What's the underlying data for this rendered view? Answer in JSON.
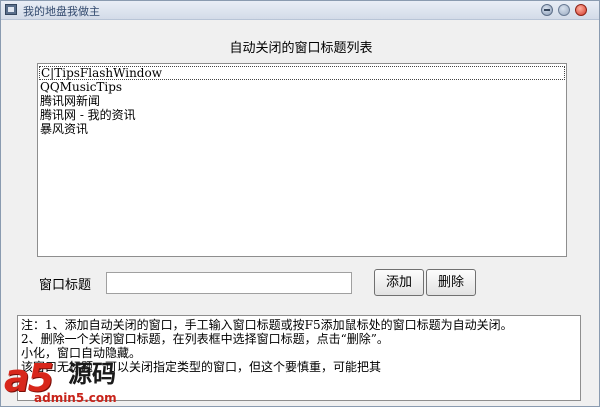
{
  "window": {
    "title": "我的地盘我做主",
    "colors": {
      "close": "#d2382a",
      "titlebar": "#d3dbe8"
    }
  },
  "list": {
    "title": "自动关闭的窗口标题列表",
    "items": [
      "C|TipsFlashWindow",
      "QQMusicTips",
      "腾讯网新闻",
      "腾讯网 - 我的资讯",
      "暴风资讯"
    ],
    "selected_index": 0
  },
  "form": {
    "label": "窗口标题",
    "input_value": "",
    "add_label": "添加",
    "delete_label": "删除"
  },
  "notes": {
    "lines": [
      "注：1、添加自动关闭的窗口，手工输入窗口标题或按F5添加鼠标处的窗口标题为自动关闭。",
      "2、删除一个关闭窗口标题，在列表框中选择窗口标题，点击“删除”。",
      "              小化，窗口自动隐藏。",
      "              该窗口无标题，可以关闭指定类型的窗口，但这个要慎重，可能把其"
    ]
  },
  "watermark": {
    "logo": "a5",
    "text": "源码",
    "url": "admin5.com"
  }
}
